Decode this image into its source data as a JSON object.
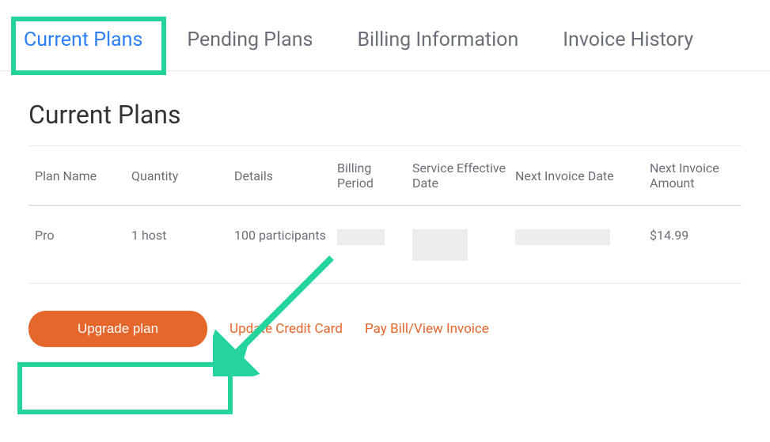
{
  "tabs": {
    "current_plans": "Current Plans",
    "pending_plans": "Pending Plans",
    "billing_information": "Billing Information",
    "invoice_history": "Invoice History"
  },
  "page_title": "Current Plans",
  "table": {
    "headers": {
      "plan_name": "Plan Name",
      "quantity": "Quantity",
      "details": "Details",
      "billing_period": "Billing Period",
      "service_effective_date": "Service Effective Date",
      "next_invoice_date": "Next Invoice Date",
      "next_invoice_amount": "Next Invoice Amount"
    },
    "rows": [
      {
        "plan_name": "Pro",
        "quantity": "1 host",
        "details": "100 participants",
        "next_invoice_amount": "$14.99"
      }
    ]
  },
  "actions": {
    "upgrade_plan": "Upgrade plan",
    "update_credit_card": "Update Credit Card",
    "pay_bill_view_invoice": "Pay Bill/View Invoice"
  }
}
